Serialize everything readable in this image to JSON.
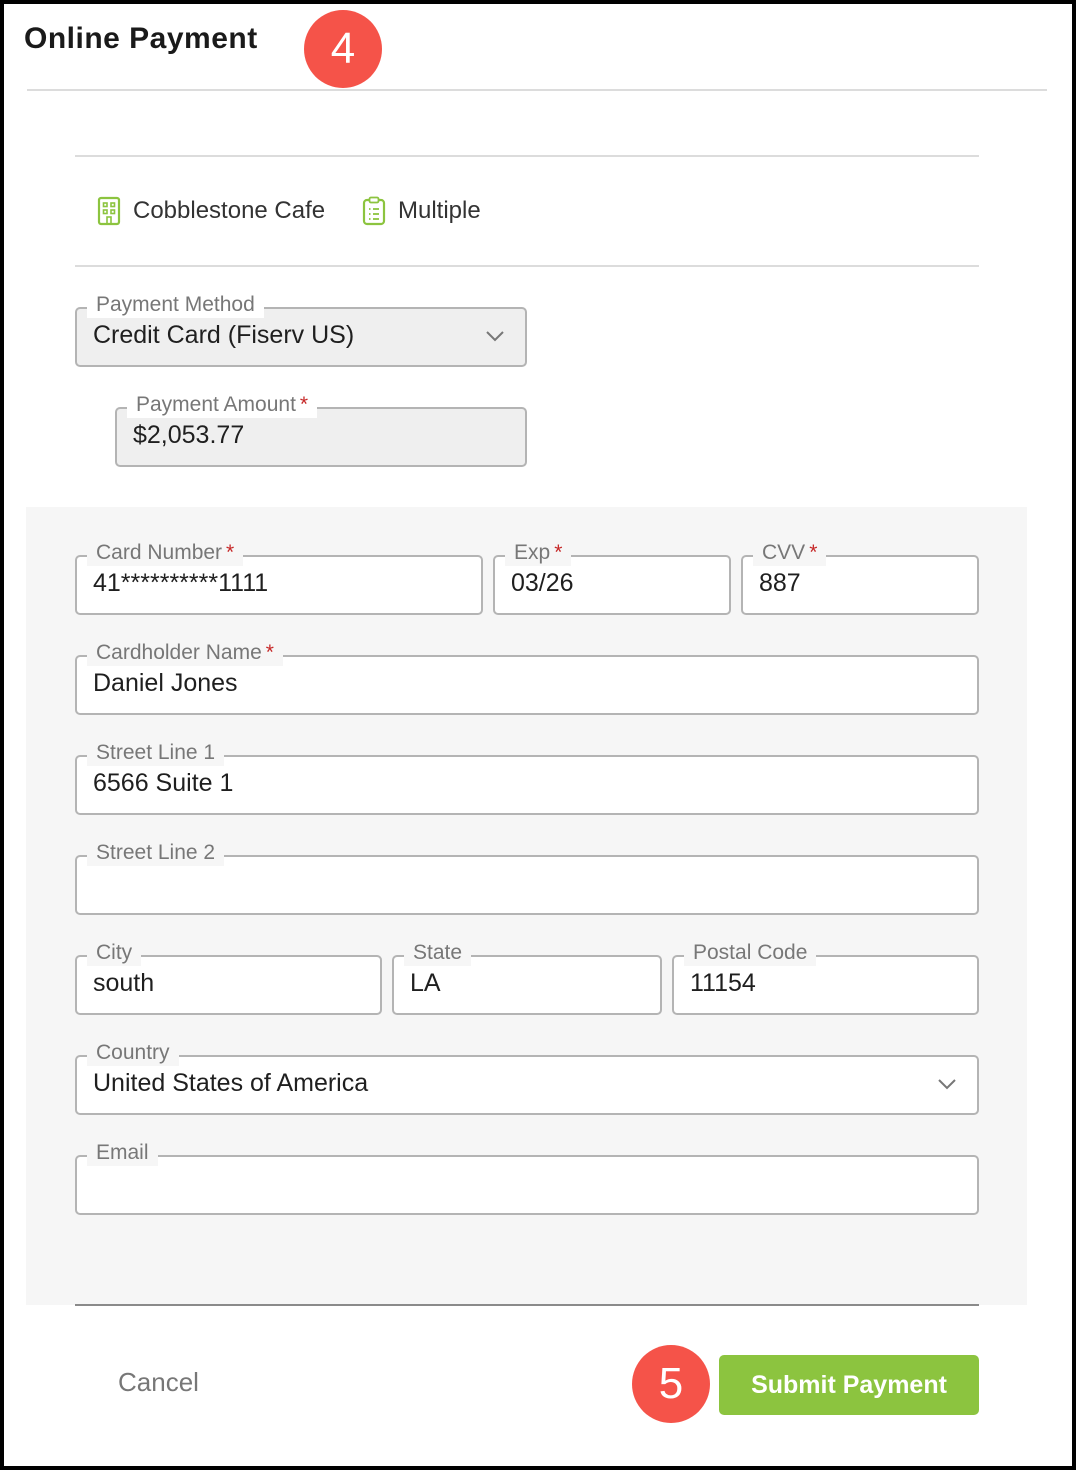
{
  "header": {
    "title": "Online Payment",
    "step_badge": "4"
  },
  "info": {
    "location": {
      "icon": "building-icon",
      "text": "Cobblestone Cafe"
    },
    "invoices": {
      "icon": "clipboard-list-icon",
      "text": "Multiple"
    }
  },
  "payment_method": {
    "label": "Payment Method",
    "value": "Credit Card (Fiserv US)"
  },
  "payment_amount": {
    "label": "Payment Amount",
    "required": "*",
    "value": "$2,053.77"
  },
  "card": {
    "number": {
      "label": "Card Number",
      "required": "*",
      "value": "41**********1111"
    },
    "exp": {
      "label": "Exp",
      "required": "*",
      "value": "03/26"
    },
    "cvv": {
      "label": "CVV",
      "required": "*",
      "value": "887"
    }
  },
  "cardholder": {
    "label": "Cardholder Name",
    "required": "*",
    "value": "Daniel Jones"
  },
  "street1": {
    "label": "Street Line 1",
    "value": "6566 Suite 1"
  },
  "street2": {
    "label": "Street Line 2",
    "value": ""
  },
  "city": {
    "label": "City",
    "value": "south"
  },
  "state": {
    "label": "State",
    "value": "LA"
  },
  "postal": {
    "label": "Postal Code",
    "value": "11154"
  },
  "country": {
    "label": "Country",
    "value": "United States of America"
  },
  "email": {
    "label": "Email",
    "value": ""
  },
  "actions": {
    "cancel": "Cancel",
    "submit": "Submit Payment",
    "step_badge": "5"
  },
  "colors": {
    "accent_green": "#8cc43f",
    "badge_red": "#f55349",
    "required_red": "#c62828"
  }
}
